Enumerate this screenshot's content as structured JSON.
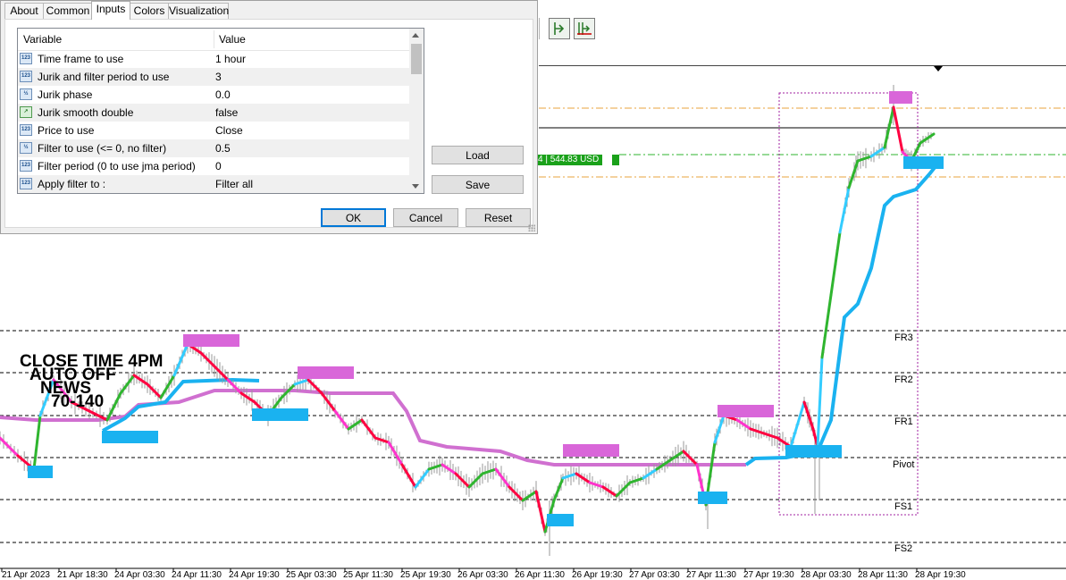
{
  "dialog": {
    "tabs": [
      "About",
      "Common",
      "Inputs",
      "Colors",
      "Visualization"
    ],
    "active_tab": "Inputs",
    "grid": {
      "col_variable": "Variable",
      "col_value": "Value",
      "rows": [
        {
          "icon": "number-icon",
          "icon_text": "123",
          "variable": "Time frame to use",
          "value": "1 hour"
        },
        {
          "icon": "number-icon",
          "icon_text": "123",
          "variable": "Jurik and filter period to use",
          "value": "3"
        },
        {
          "icon": "decimal-icon",
          "icon_text": "½",
          "variable": "Jurik phase",
          "value": "0.0"
        },
        {
          "icon": "boolean-icon",
          "icon_text": "↗",
          "variable": "Jurik smooth double",
          "value": "false"
        },
        {
          "icon": "number-icon",
          "icon_text": "123",
          "variable": "Price to use",
          "value": "Close"
        },
        {
          "icon": "decimal-icon",
          "icon_text": "½",
          "variable": "Filter to use (<= 0, no filter)",
          "value": "0.5"
        },
        {
          "icon": "number-icon",
          "icon_text": "123",
          "variable": "Filter period (0 to use jma period)",
          "value": "0"
        },
        {
          "icon": "number-icon",
          "icon_text": "123",
          "variable": "Apply filter to :",
          "value": "Filter all"
        }
      ]
    },
    "load_label": "Load",
    "save_label": "Save",
    "ok_label": "OK",
    "cancel_label": "Cancel",
    "reset_label": "Reset"
  },
  "chart": {
    "price_tag": "544.83 USD",
    "price_tag_prefix": "4",
    "overlay_text": [
      "CLOSE TIME 4PM",
      "AUTO OFF",
      "NEWS",
      "70-140"
    ],
    "levels": [
      "FR3",
      "FR2",
      "FR1",
      "Pivot",
      "FS1",
      "FS2"
    ],
    "dates": [
      "21 Apr 2023",
      "21 Apr 18:30",
      "24 Apr 03:30",
      "24 Apr 11:30",
      "24 Apr 19:30",
      "25 Apr 03:30",
      "25 Apr 11:30",
      "25 Apr 19:30",
      "26 Apr 03:30",
      "26 Apr 11:30",
      "26 Apr 19:30",
      "27 Apr 03:30",
      "27 Apr 11:30",
      "27 Apr 19:30",
      "28 Apr 03:30",
      "28 Apr 11:30",
      "28 Apr 19:30"
    ],
    "colors": {
      "up": "#2fb52f",
      "down": "#ff0040",
      "fast_up": "#33ccff",
      "fast_down": "#ff33cc",
      "slow_up": "#1ab2f0",
      "slow_down": "#d070d0",
      "box_magenta": "#d966d9",
      "box_cyan": "#1ab2f0",
      "level_orange": "#e8a33d",
      "level_green": "#2fb52f"
    }
  }
}
